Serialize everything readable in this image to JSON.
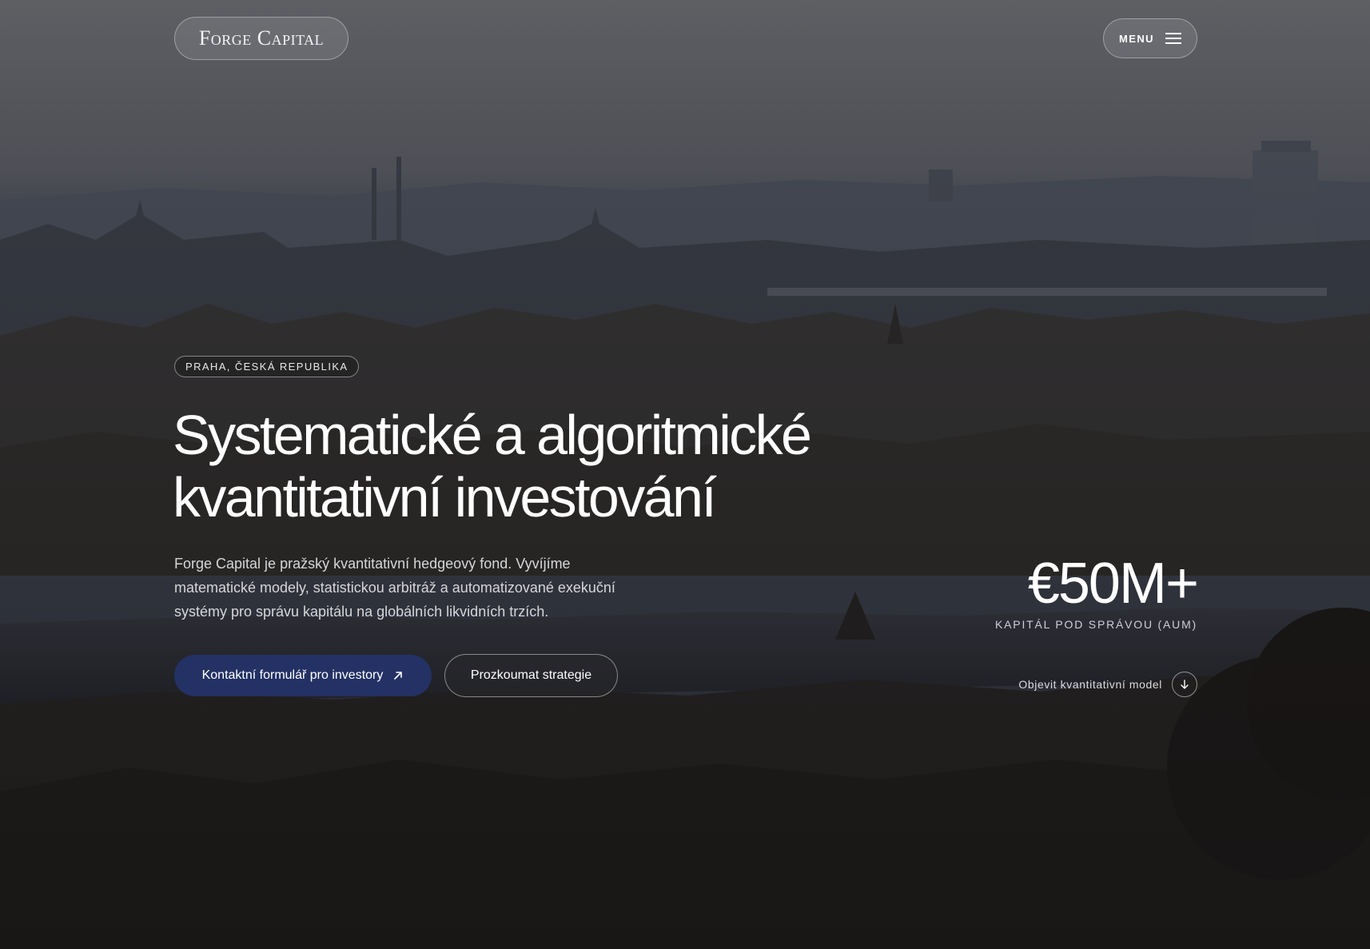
{
  "header": {
    "logo": "Forge Capital",
    "menu_label": "MENU"
  },
  "hero": {
    "location": "PRAHA, ČESKÁ REPUBLIKA",
    "title_line1": "Systematické a algoritmické",
    "title_line2": "kvantitativní investování",
    "description": "Forge Capital je pražský kvantitativní hedgeový fond. Vyvíjíme matematické modely, statistickou arbitráž a automatizované exekuční systémy pro správu kapitálu na globálních likvidních trzích.",
    "primary_cta": "Kontaktní formulář pro investory",
    "secondary_cta": "Prozkoumat strategie"
  },
  "stats": {
    "aum_value": "€50M+",
    "aum_label": "KAPITÁL POD SPRÁVOU (AUM)",
    "explore_label": "Objevit kvantitativní model"
  },
  "icons": {
    "menu": "hamburger-icon",
    "primary_cta": "arrow-up-right-icon",
    "explore": "arrow-down-icon"
  },
  "colors": {
    "primary_button": "#233164",
    "background": "#2a2b2f"
  }
}
